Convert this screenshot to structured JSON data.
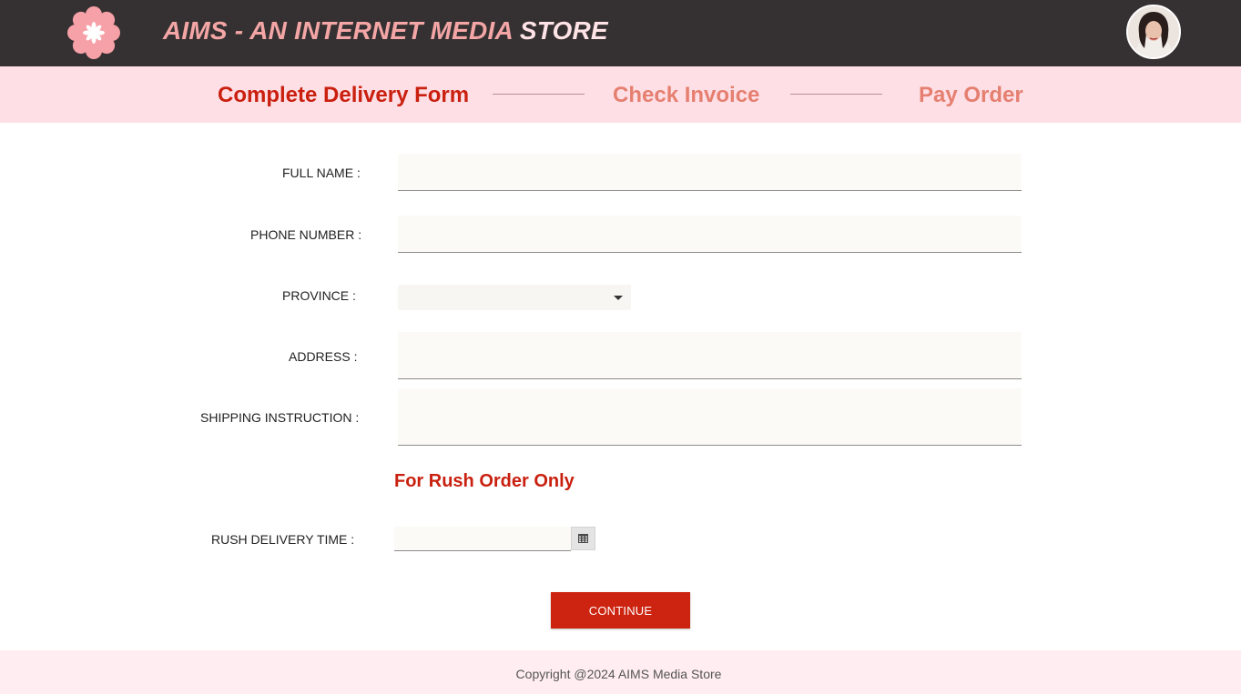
{
  "header": {
    "title_prefix": "AIMS - AN INTERNET MEDIA ",
    "title_suffix": "STORE",
    "logo_icon": "flower-icon",
    "avatar_icon": "user-avatar",
    "colors": {
      "bar": "#353031",
      "title": "#f4a6a6",
      "logo": "#f6a0a8"
    }
  },
  "steps": [
    {
      "label": "Complete Delivery Form",
      "state": "active"
    },
    {
      "label": "Check Invoice",
      "state": "inactive"
    },
    {
      "label": "Pay Order",
      "state": "inactive"
    }
  ],
  "form": {
    "full_name": {
      "label": "FULL NAME :",
      "value": ""
    },
    "phone_number": {
      "label": "PHONE NUMBER :",
      "value": ""
    },
    "province": {
      "label": "PROVINCE :",
      "selected": ""
    },
    "address": {
      "label": "ADDRESS :",
      "value": ""
    },
    "shipping_instruction": {
      "label": "SHIPPING INSTRUCTION :",
      "value": ""
    },
    "rush_section_title": "For Rush Order Only",
    "rush_delivery_time": {
      "label": "RUSH DELIVERY TIME :",
      "value": "",
      "icon": "calendar-icon"
    },
    "continue_label": "CONTINUE"
  },
  "footer": {
    "copyright": "Copyright @2024 AIMS Media Store"
  },
  "colors": {
    "accent": "#c9200f",
    "step_inactive": "#e57f6f",
    "steps_bg": "#ffdfe6",
    "footer_bg": "#ffedf2",
    "button": "#cc2410"
  }
}
